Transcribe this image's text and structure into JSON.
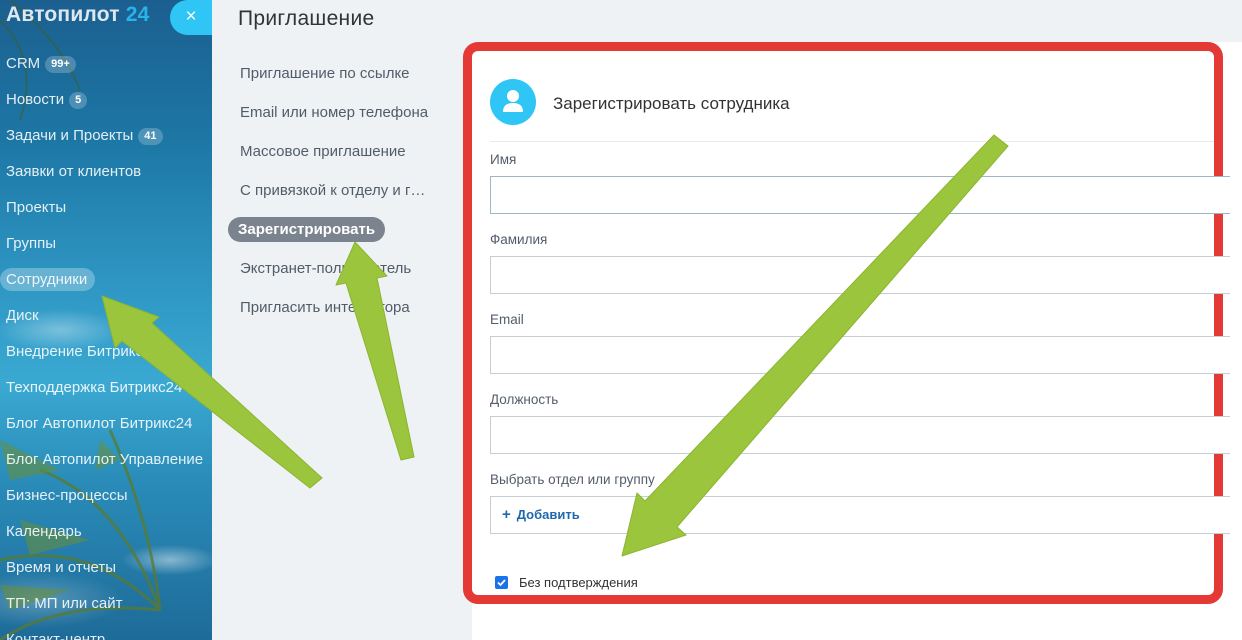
{
  "sidebar": {
    "logo_text": "Автопилот",
    "logo_number": "24",
    "close_label": "×",
    "items": [
      {
        "label": "CRM",
        "badge": "99+"
      },
      {
        "label": "Новости",
        "badge": "5"
      },
      {
        "label": "Задачи и Проекты",
        "badge": "41"
      },
      {
        "label": "Заявки от клиентов",
        "badge": null
      },
      {
        "label": "Проекты",
        "badge": null
      },
      {
        "label": "Группы",
        "badge": null
      },
      {
        "label": "Сотрудники",
        "badge": null,
        "active": true
      },
      {
        "label": "Диск",
        "badge": null
      },
      {
        "label": "Внедрение Битрикс24",
        "badge": null
      },
      {
        "label": "Техподдержка Битрикс24",
        "badge": null
      },
      {
        "label": "Блог Автопилот Битрикс24",
        "badge": null
      },
      {
        "label": "Блог Автопилот Управление",
        "badge": null
      },
      {
        "label": "Бизнес-процессы",
        "badge": null
      },
      {
        "label": "Календарь",
        "badge": null
      },
      {
        "label": "Время и отчеты",
        "badge": null
      },
      {
        "label": "ТП: МП или сайт",
        "badge": null
      },
      {
        "label": "Контакт-центр",
        "badge": null
      }
    ]
  },
  "invite": {
    "title": "Приглашение",
    "nav": [
      {
        "label": "Приглашение по ссылке"
      },
      {
        "label": "Email или номер телефона"
      },
      {
        "label": "Массовое приглашение"
      },
      {
        "label": "С привязкой к отделу и группе"
      },
      {
        "label": "Зарегистрировать",
        "active": true
      },
      {
        "label": "Экстранет-пользователь"
      },
      {
        "label": "Пригласить интегратора"
      }
    ]
  },
  "form": {
    "header_title": "Зарегистрировать сотрудника",
    "avatar_icon": "user-icon",
    "first_name_label": "Имя",
    "first_name_value": "",
    "last_name_label": "Фамилия",
    "last_name_value": "",
    "email_label": "Email",
    "email_value": "",
    "position_label": "Должность",
    "position_value": "",
    "department_label": "Выбрать отдел или группу",
    "add_label": "Добавить",
    "no_confirm_label": "Без подтверждения",
    "no_confirm_checked": true
  },
  "colors": {
    "highlight_frame": "#e53935",
    "arrow": "#9bc53d",
    "accent": "#2fc6f6"
  }
}
